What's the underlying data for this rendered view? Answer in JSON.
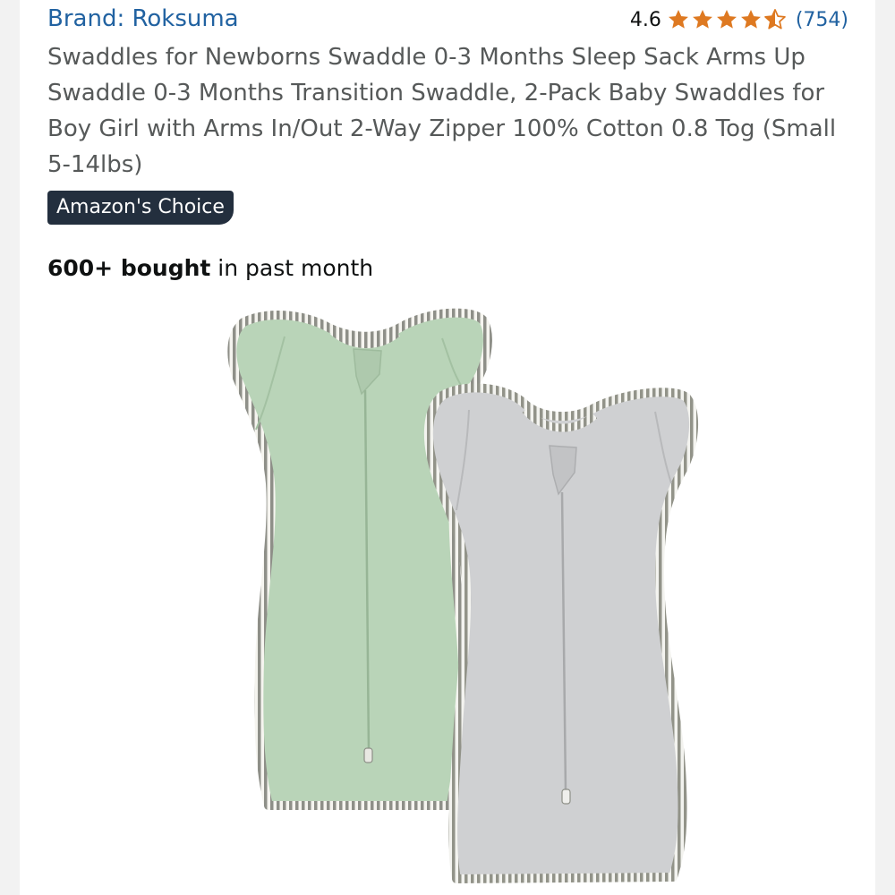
{
  "brand_link": "Brand: Roksuma",
  "rating": {
    "value": "4.6",
    "stars": 4.6,
    "count": "(754)",
    "star_color": "#de7921"
  },
  "title": "Swaddles for Newborns Swaddle 0-3 Months Sleep Sack Arms Up Swaddle 0-3 Months Transition Swaddle, 2-Pack Baby Swaddles for Boy Girl with Arms In/Out 2-Way Zipper 100% Cotton 0.8 Tog (Small 5-14lbs)",
  "badge": "Amazon's Choice",
  "bought": {
    "bold": "600+ bought",
    "rest": " in past month"
  },
  "colors": {
    "link": "#2162a1",
    "badge_bg": "#232f3e",
    "sage_swaddle": "#b9d4b8",
    "gray_swaddle": "#cfd0d2",
    "trim_stripe": "#8e8f88"
  }
}
